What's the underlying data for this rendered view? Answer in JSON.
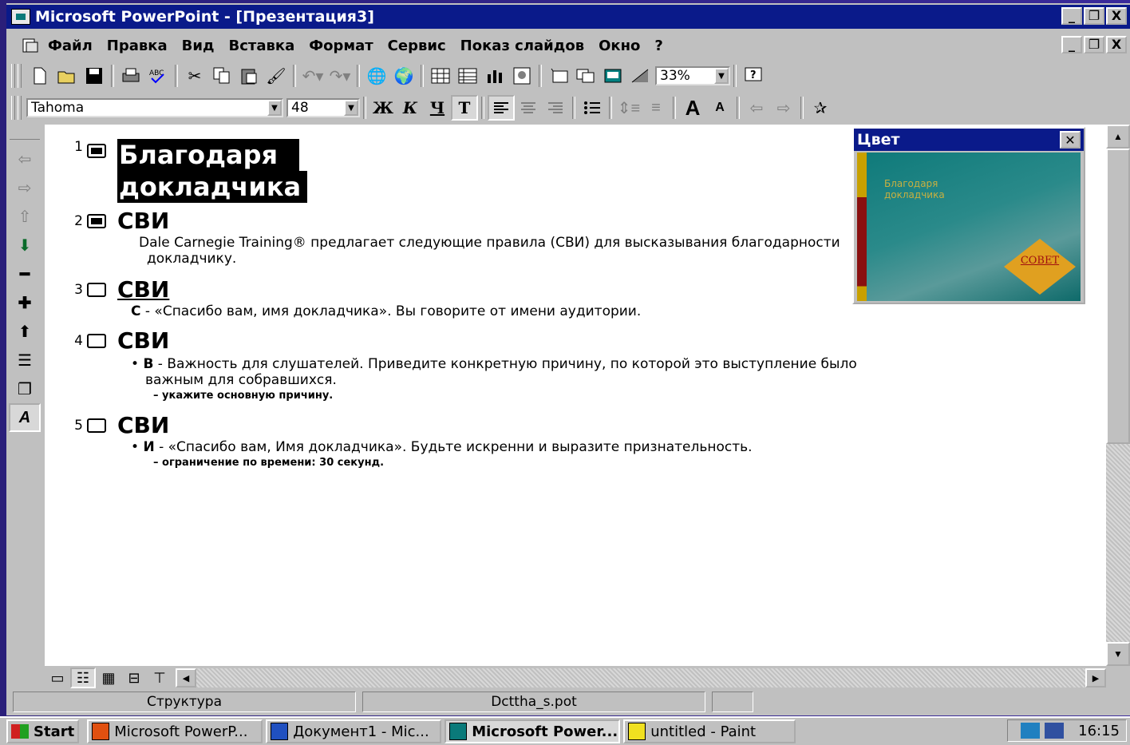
{
  "window": {
    "title": "Microsoft PowerPoint - [Презентация3]",
    "controls": [
      "_",
      "❐",
      "X"
    ]
  },
  "menu": [
    "Файл",
    "Правка",
    "Вид",
    "Вставка",
    "Формат",
    "Сервис",
    "Показ слайдов",
    "Окно",
    "?"
  ],
  "toolbar": {
    "zoom": "33%",
    "font": "Tahoma",
    "font_size": "48",
    "bold_label": "Ж",
    "italic_label": "К",
    "underline_label": "Ч",
    "shadow_label": "T"
  },
  "outline": {
    "slides": [
      {
        "num": "1",
        "title_lines": [
          "Благодаря",
          "докладчика"
        ]
      },
      {
        "num": "2",
        "title": "СВИ",
        "body": [
          "Dale Carnegie Training® предлагает следующие правила (СВИ) для высказывания благодарности",
          "докладчику."
        ]
      },
      {
        "num": "3",
        "title": "СВИ",
        "body_key": "С",
        "body": " - «Спасибо вам, имя докладчика».  Вы говорите от имени аудитории."
      },
      {
        "num": "4",
        "title": "СВИ",
        "body_key": "В",
        "body": [
          " - Важность для слушателей.  Приведите конкретную причину, по которой это выступление было",
          "важным для собравшихся."
        ],
        "sub": "укажите основную причину."
      },
      {
        "num": "5",
        "title": "СВИ",
        "body_key": "И",
        "body": " - «Спасибо вам, Имя докладчика».  Будьте искренни и выразите признательность.",
        "sub": "ограничение по времени: 30 секунд."
      }
    ]
  },
  "color_window": {
    "title": "Цвет",
    "slide_title": [
      "Благодаря",
      "докладчика"
    ],
    "badge": "СОВЕТ"
  },
  "status": {
    "view": "Структура",
    "template": "Dcttha_s.pot"
  },
  "taskbar": {
    "start": "Start",
    "tasks": [
      "Microsoft PowerP...",
      "Документ1 - Mic...",
      "Microsoft Power...",
      "untitled - Paint"
    ],
    "clock": "16:15"
  },
  "colors": {
    "titlebar": "#0a1a8a",
    "face": "#c0c0c0",
    "desktop": "#2a1f7a"
  }
}
